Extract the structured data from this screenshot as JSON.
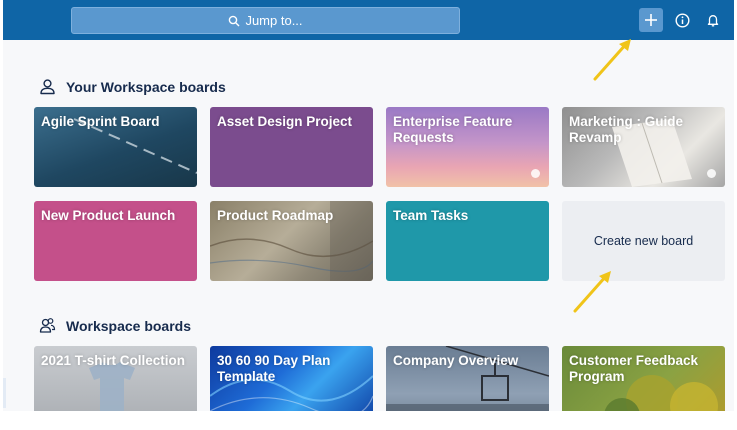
{
  "header": {
    "search_label": "Jump to...",
    "icons": [
      "search-icon",
      "plus-icon",
      "info-icon",
      "bell-icon"
    ]
  },
  "sections": {
    "personal": {
      "title": "Your Workspace boards",
      "icon": "user-icon"
    },
    "workspace": {
      "title": "Workspace boards",
      "icon": "team-icon"
    }
  },
  "boards": [
    "Agile Sprint Board",
    "Asset Design Project",
    "Enterprise Feature Requests",
    "Marketing : Guide Revamp",
    "New Product Launch",
    "Product Roadmap",
    "Team Tasks"
  ],
  "create_board_label": "Create new board",
  "workspace_boards": [
    "2021 T-shirt Collection",
    "30 60 90 Day Plan Template",
    "Company Overview",
    "Customer Feedback Program"
  ],
  "colors": {
    "header": "#0f65a6",
    "annotation_arrow": "#f0c419"
  }
}
